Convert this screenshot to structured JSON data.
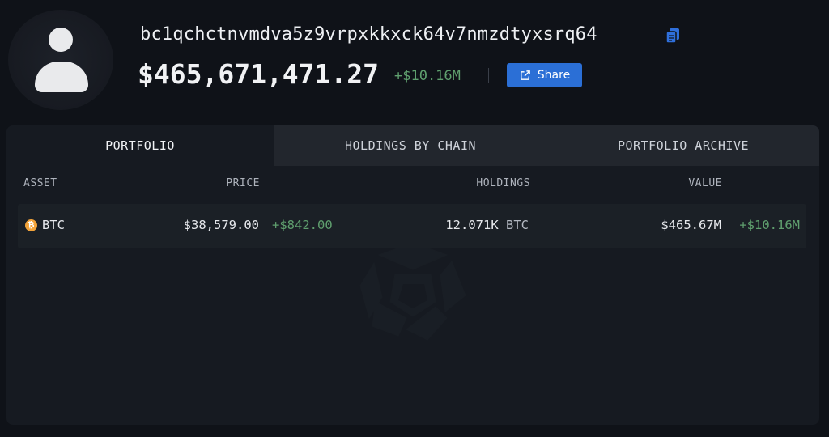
{
  "wallet": {
    "address": "bc1qchctnvmdva5z9vrpxkkxck64v7nmzdtyxsrq64",
    "total_value": "$465,671,471.27",
    "total_change": "+$10.16M",
    "share_label": "Share"
  },
  "icons": {
    "avatar": "user-silhouette-icon",
    "copy": "copy-icon",
    "share": "external-link-icon",
    "asset": "bitcoin-icon",
    "watermark": "arkham-logo-icon"
  },
  "tabs": [
    {
      "label": "PORTFOLIO",
      "active": true
    },
    {
      "label": "HOLDINGS BY CHAIN",
      "active": false
    },
    {
      "label": "PORTFOLIO ARCHIVE",
      "active": false
    }
  ],
  "table": {
    "headers": [
      "ASSET",
      "PRICE",
      "HOLDINGS",
      "VALUE"
    ],
    "rows": [
      {
        "asset": "BTC",
        "asset_glyph": "₿",
        "price": "$38,579.00",
        "price_change": "+$842.00",
        "holdings": "12.071K",
        "holdings_unit": "BTC",
        "value": "$465.67M",
        "value_change": "+$10.16M"
      }
    ]
  },
  "colors": {
    "background": "#0f1218",
    "panel": "#161a21",
    "accent_blue": "#2b6fd6",
    "positive_green": "#5f9f6e",
    "bitcoin_orange": "#f2a33a"
  }
}
